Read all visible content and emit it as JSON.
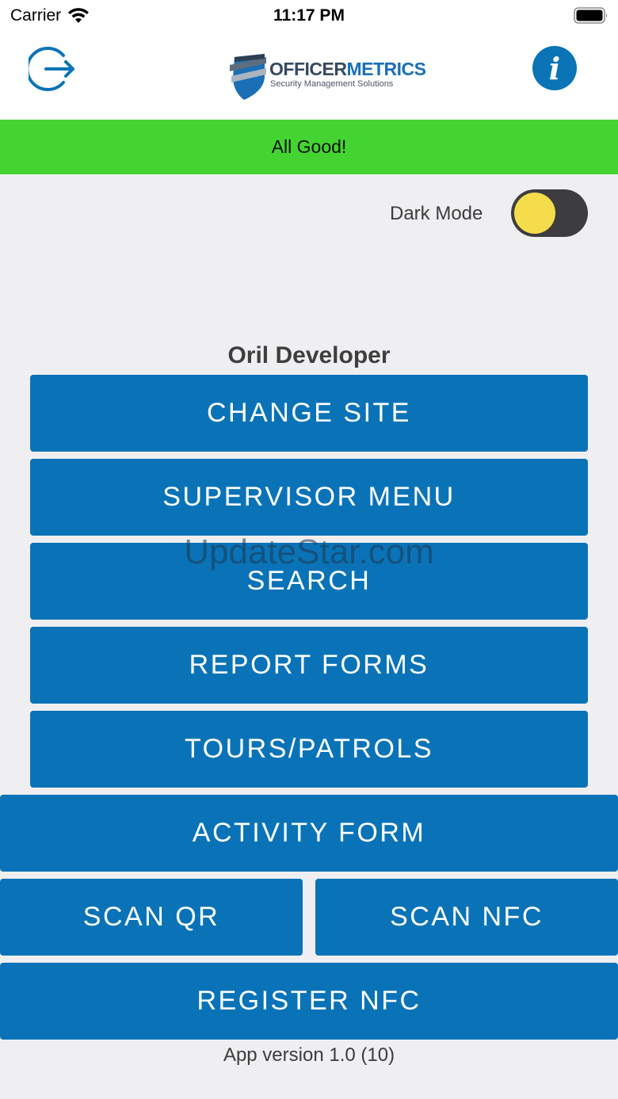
{
  "status_bar": {
    "carrier": "Carrier",
    "time": "11:17 PM"
  },
  "header": {
    "logo_name_part1": "OFFICER",
    "logo_name_part2": "METRICS",
    "logo_tagline": "Security Management Solutions",
    "logout_icon": "logout-icon",
    "info_icon": "info-icon",
    "info_glyph": "i"
  },
  "banner": {
    "text": "All Good!",
    "color": "#44d432"
  },
  "dark_mode": {
    "label": "Dark Mode",
    "enabled": false
  },
  "user": {
    "name": "Oril Developer"
  },
  "buttons": {
    "change_site": "CHANGE SITE",
    "supervisor_menu": "SUPERVISOR MENU",
    "search": "SEARCH",
    "report_forms": "REPORT FORMS",
    "tours_patrols": "TOURS/PATROLS",
    "activity_form": "ACTIVITY FORM",
    "scan_qr": "SCAN QR",
    "scan_nfc": "SCAN NFC",
    "register_nfc": "REGISTER NFC"
  },
  "watermark": "UpdateStar.com",
  "footer": {
    "version": "App version 1.0 (10)"
  },
  "colors": {
    "primary": "#0a73b7",
    "background": "#efeff2",
    "toggle_knob": "#f5dc4a"
  }
}
